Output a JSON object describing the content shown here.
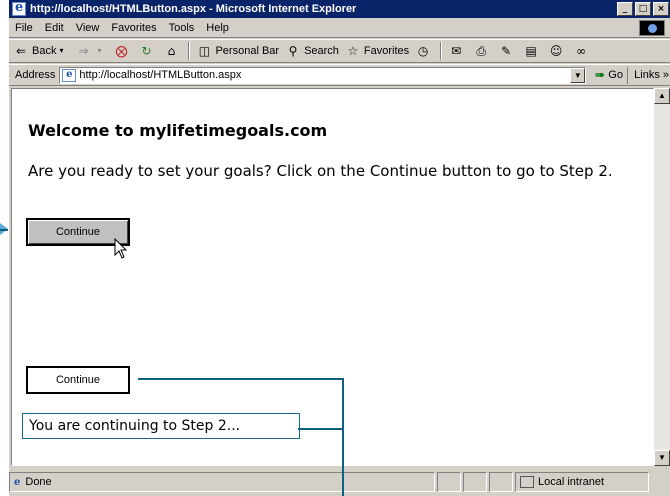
{
  "window": {
    "title": "http://localhost/HTMLButton.aspx - Microsoft Internet Explorer",
    "controls": {
      "minimize": "_",
      "maximize": "□",
      "close": "×"
    }
  },
  "menu": [
    "File",
    "Edit",
    "View",
    "Favorites",
    "Tools",
    "Help"
  ],
  "toolbar": {
    "back": "Back",
    "personal_bar": "Personal Bar",
    "search": "Search",
    "favorites": "Favorites"
  },
  "address": {
    "label": "Address",
    "url": "http://localhost/HTMLButton.aspx",
    "go": "Go",
    "links": "Links »"
  },
  "page": {
    "heading": "Welcome to mylifetimegoals.com",
    "intro": "Are you ready to set your goals? Click on the Continue button to go to Step 2.",
    "button1_label": "Continue",
    "button2_label": "Continue",
    "status_label": "You are continuing to Step 2..."
  },
  "statusbar": {
    "status": "Done",
    "zone": "Local intranet"
  },
  "colors": {
    "titlebar": "#0a246a",
    "callout": "#0d5f86",
    "arrow": "#5aa8d8"
  }
}
